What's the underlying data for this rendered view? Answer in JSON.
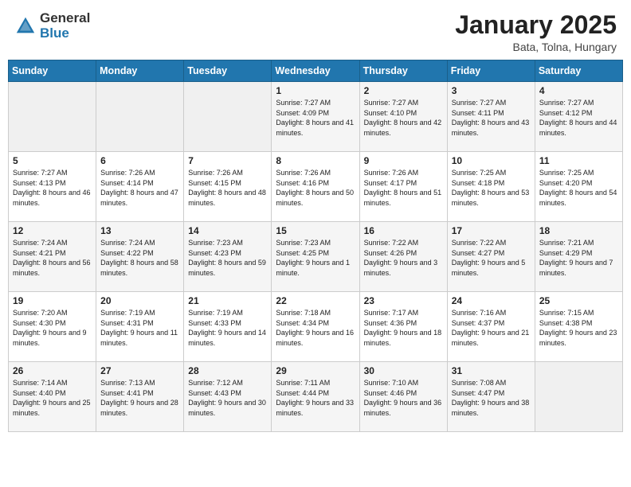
{
  "header": {
    "logo_general": "General",
    "logo_blue": "Blue",
    "month_title": "January 2025",
    "location": "Bata, Tolna, Hungary"
  },
  "days_of_week": [
    "Sunday",
    "Monday",
    "Tuesday",
    "Wednesday",
    "Thursday",
    "Friday",
    "Saturday"
  ],
  "weeks": [
    [
      {
        "day": "",
        "info": ""
      },
      {
        "day": "",
        "info": ""
      },
      {
        "day": "",
        "info": ""
      },
      {
        "day": "1",
        "info": "Sunrise: 7:27 AM\nSunset: 4:09 PM\nDaylight: 8 hours and 41 minutes."
      },
      {
        "day": "2",
        "info": "Sunrise: 7:27 AM\nSunset: 4:10 PM\nDaylight: 8 hours and 42 minutes."
      },
      {
        "day": "3",
        "info": "Sunrise: 7:27 AM\nSunset: 4:11 PM\nDaylight: 8 hours and 43 minutes."
      },
      {
        "day": "4",
        "info": "Sunrise: 7:27 AM\nSunset: 4:12 PM\nDaylight: 8 hours and 44 minutes."
      }
    ],
    [
      {
        "day": "5",
        "info": "Sunrise: 7:27 AM\nSunset: 4:13 PM\nDaylight: 8 hours and 46 minutes."
      },
      {
        "day": "6",
        "info": "Sunrise: 7:26 AM\nSunset: 4:14 PM\nDaylight: 8 hours and 47 minutes."
      },
      {
        "day": "7",
        "info": "Sunrise: 7:26 AM\nSunset: 4:15 PM\nDaylight: 8 hours and 48 minutes."
      },
      {
        "day": "8",
        "info": "Sunrise: 7:26 AM\nSunset: 4:16 PM\nDaylight: 8 hours and 50 minutes."
      },
      {
        "day": "9",
        "info": "Sunrise: 7:26 AM\nSunset: 4:17 PM\nDaylight: 8 hours and 51 minutes."
      },
      {
        "day": "10",
        "info": "Sunrise: 7:25 AM\nSunset: 4:18 PM\nDaylight: 8 hours and 53 minutes."
      },
      {
        "day": "11",
        "info": "Sunrise: 7:25 AM\nSunset: 4:20 PM\nDaylight: 8 hours and 54 minutes."
      }
    ],
    [
      {
        "day": "12",
        "info": "Sunrise: 7:24 AM\nSunset: 4:21 PM\nDaylight: 8 hours and 56 minutes."
      },
      {
        "day": "13",
        "info": "Sunrise: 7:24 AM\nSunset: 4:22 PM\nDaylight: 8 hours and 58 minutes."
      },
      {
        "day": "14",
        "info": "Sunrise: 7:23 AM\nSunset: 4:23 PM\nDaylight: 8 hours and 59 minutes."
      },
      {
        "day": "15",
        "info": "Sunrise: 7:23 AM\nSunset: 4:25 PM\nDaylight: 9 hours and 1 minute."
      },
      {
        "day": "16",
        "info": "Sunrise: 7:22 AM\nSunset: 4:26 PM\nDaylight: 9 hours and 3 minutes."
      },
      {
        "day": "17",
        "info": "Sunrise: 7:22 AM\nSunset: 4:27 PM\nDaylight: 9 hours and 5 minutes."
      },
      {
        "day": "18",
        "info": "Sunrise: 7:21 AM\nSunset: 4:29 PM\nDaylight: 9 hours and 7 minutes."
      }
    ],
    [
      {
        "day": "19",
        "info": "Sunrise: 7:20 AM\nSunset: 4:30 PM\nDaylight: 9 hours and 9 minutes."
      },
      {
        "day": "20",
        "info": "Sunrise: 7:19 AM\nSunset: 4:31 PM\nDaylight: 9 hours and 11 minutes."
      },
      {
        "day": "21",
        "info": "Sunrise: 7:19 AM\nSunset: 4:33 PM\nDaylight: 9 hours and 14 minutes."
      },
      {
        "day": "22",
        "info": "Sunrise: 7:18 AM\nSunset: 4:34 PM\nDaylight: 9 hours and 16 minutes."
      },
      {
        "day": "23",
        "info": "Sunrise: 7:17 AM\nSunset: 4:36 PM\nDaylight: 9 hours and 18 minutes."
      },
      {
        "day": "24",
        "info": "Sunrise: 7:16 AM\nSunset: 4:37 PM\nDaylight: 9 hours and 21 minutes."
      },
      {
        "day": "25",
        "info": "Sunrise: 7:15 AM\nSunset: 4:38 PM\nDaylight: 9 hours and 23 minutes."
      }
    ],
    [
      {
        "day": "26",
        "info": "Sunrise: 7:14 AM\nSunset: 4:40 PM\nDaylight: 9 hours and 25 minutes."
      },
      {
        "day": "27",
        "info": "Sunrise: 7:13 AM\nSunset: 4:41 PM\nDaylight: 9 hours and 28 minutes."
      },
      {
        "day": "28",
        "info": "Sunrise: 7:12 AM\nSunset: 4:43 PM\nDaylight: 9 hours and 30 minutes."
      },
      {
        "day": "29",
        "info": "Sunrise: 7:11 AM\nSunset: 4:44 PM\nDaylight: 9 hours and 33 minutes."
      },
      {
        "day": "30",
        "info": "Sunrise: 7:10 AM\nSunset: 4:46 PM\nDaylight: 9 hours and 36 minutes."
      },
      {
        "day": "31",
        "info": "Sunrise: 7:08 AM\nSunset: 4:47 PM\nDaylight: 9 hours and 38 minutes."
      },
      {
        "day": "",
        "info": ""
      }
    ]
  ]
}
